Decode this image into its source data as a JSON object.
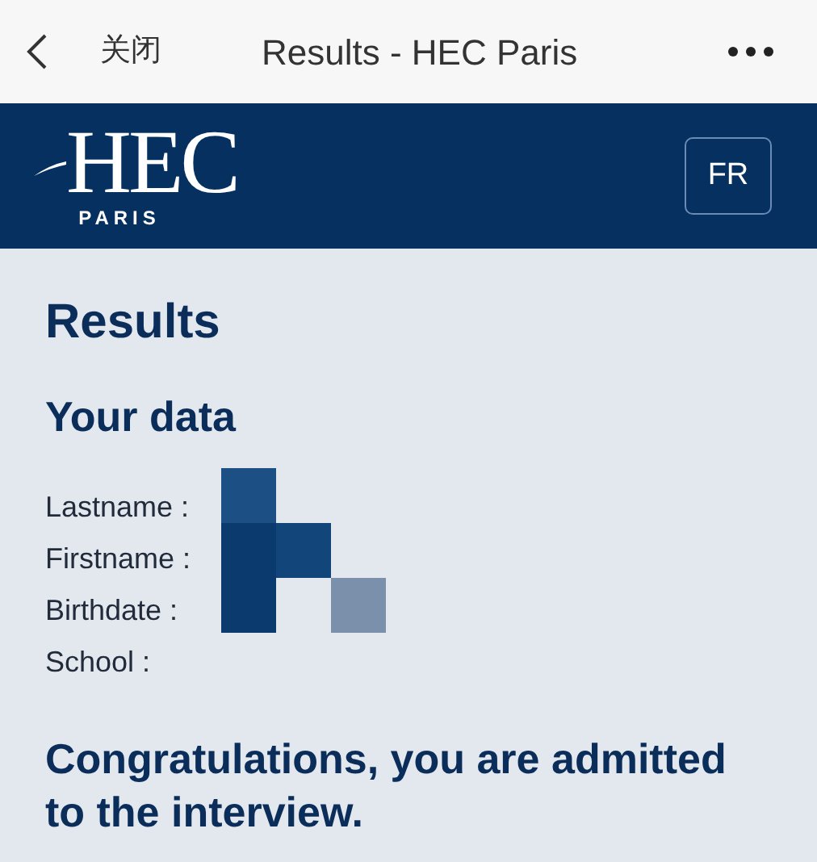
{
  "nav_bar": {
    "close_label": "关闭",
    "title": "Results - HEC Paris"
  },
  "header": {
    "logo_text": "HEC",
    "logo_subtext": "PARIS",
    "language_button": "FR"
  },
  "content": {
    "heading": "Results",
    "section_title": "Your data",
    "fields": [
      {
        "label": "Lastname :"
      },
      {
        "label": "Firstname :"
      },
      {
        "label": "Birthdate :"
      },
      {
        "label": "School :"
      }
    ],
    "message": "Congratulations, you are admitted to the interview."
  }
}
